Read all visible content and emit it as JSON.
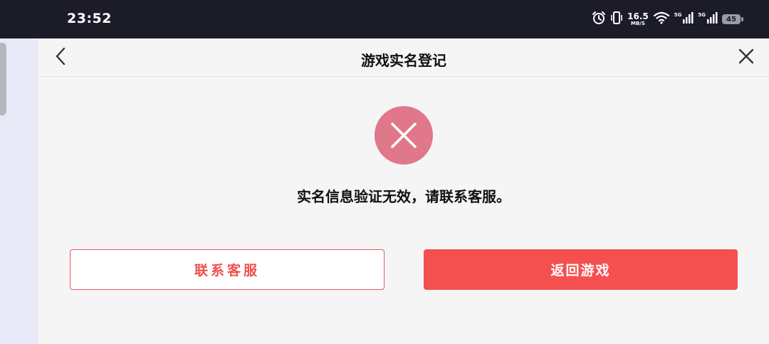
{
  "status_bar": {
    "time": "23:52",
    "speed_value": "16.5",
    "speed_unit": "MB/S",
    "sim1_tag": "5G",
    "sim2_tag": "5G",
    "battery": "45",
    "icons": [
      "alarm-icon",
      "vibrate-icon",
      "wifi-icon",
      "signal-icon",
      "signal-icon",
      "battery-icon"
    ]
  },
  "navbar": {
    "title": "游戏实名登记",
    "back_icon": "chevron-left-icon",
    "close_icon": "close-icon"
  },
  "result": {
    "icon": "error-x-icon",
    "icon_color": "#e0778a",
    "message": "实名信息验证无效，请联系客服。"
  },
  "actions": {
    "contact_label": "联系客服",
    "return_label": "返回游戏",
    "accent_color": "#f55050"
  }
}
